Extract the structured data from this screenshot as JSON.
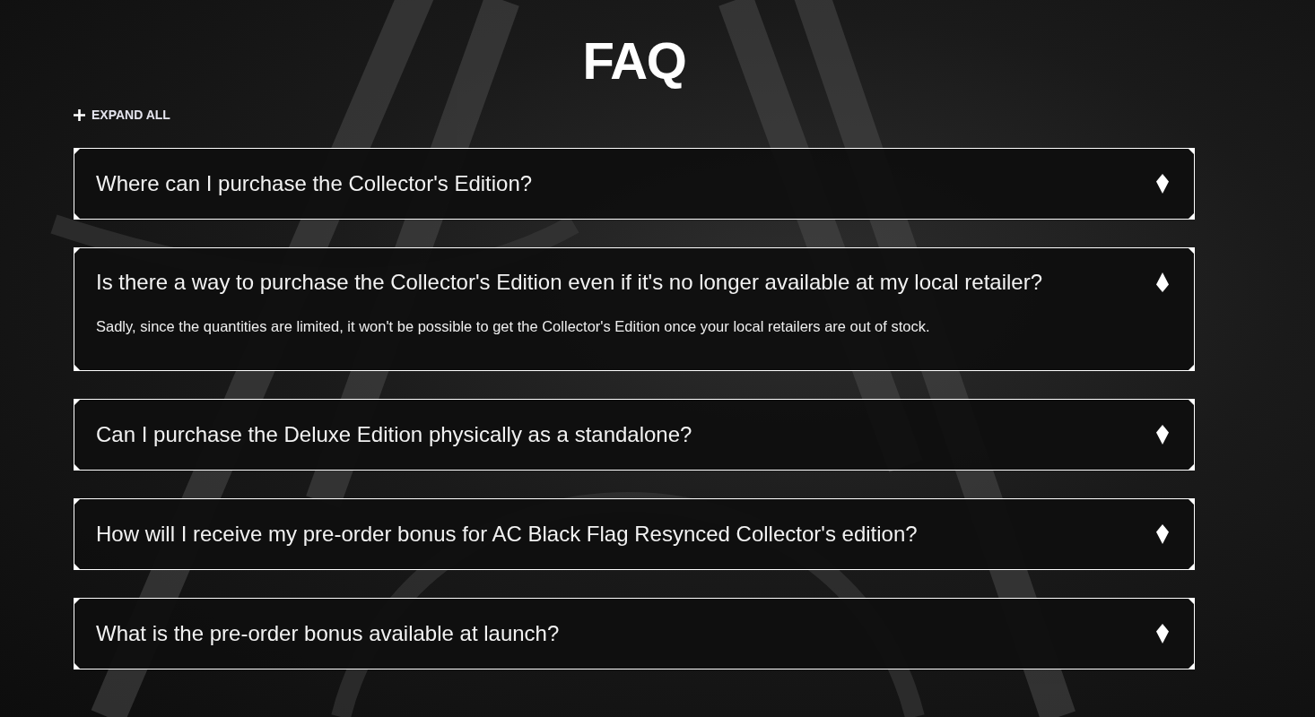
{
  "title": "FAQ",
  "expand_all": {
    "label": "EXPAND ALL"
  },
  "items": [
    {
      "question": "Where can I purchase the Collector's Edition?",
      "expanded": false
    },
    {
      "question": "Is there a way to purchase the Collector's Edition even if it's no longer available at my local retailer?",
      "expanded": true,
      "answer": "Sadly, since the quantities are limited, it won't be possible to get the Collector's Edition once your local retailers are out of stock."
    },
    {
      "question": "Can I purchase the Deluxe Edition physically as a standalone?",
      "expanded": false
    },
    {
      "question": "How will I receive my pre-order bonus for AC Black Flag Resynced Collector's edition?",
      "expanded": false
    },
    {
      "question": "What is the pre-order bonus available at launch?",
      "expanded": false
    }
  ]
}
